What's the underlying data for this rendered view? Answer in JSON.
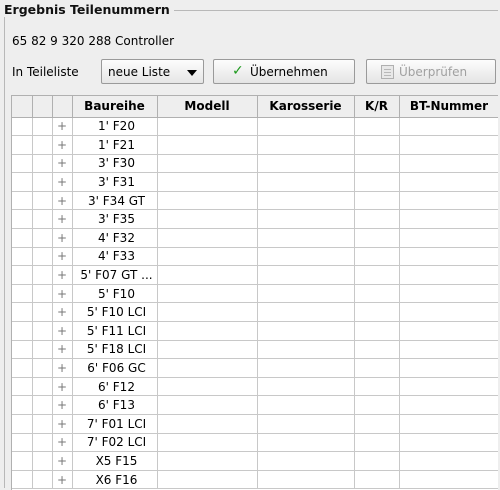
{
  "panel": {
    "title": "Ergebnis Teilenummern",
    "part_line": "65 82 9 320 288 Controller"
  },
  "toolbar": {
    "list_label": "In Teileliste",
    "list_select_value": "neue Liste",
    "apply_label": "Übernehmen",
    "check_label": "Überprüfen",
    "apply_icon": "checkmark-icon",
    "check_icon": "document-icon",
    "apply_icon_color": "#1e9a1e"
  },
  "table": {
    "columns": [
      "",
      "",
      "",
      "Baureihe",
      "Modell",
      "Karosserie",
      "K/R",
      "BT-Nummer"
    ],
    "rows": [
      {
        "expand": "+",
        "baureihe": "1' F20"
      },
      {
        "expand": "+",
        "baureihe": "1' F21"
      },
      {
        "expand": "+",
        "baureihe": "3' F30"
      },
      {
        "expand": "+",
        "baureihe": "3' F31"
      },
      {
        "expand": "+",
        "baureihe": "3' F34 GT"
      },
      {
        "expand": "+",
        "baureihe": "3' F35"
      },
      {
        "expand": "+",
        "baureihe": "4' F32"
      },
      {
        "expand": "+",
        "baureihe": "4' F33"
      },
      {
        "expand": "+",
        "baureihe": "5' F07 GT ..."
      },
      {
        "expand": "+",
        "baureihe": "5' F10"
      },
      {
        "expand": "+",
        "baureihe": "5' F10 LCI"
      },
      {
        "expand": "+",
        "baureihe": "5' F11 LCI"
      },
      {
        "expand": "+",
        "baureihe": "5' F18 LCI"
      },
      {
        "expand": "+",
        "baureihe": "6' F06 GC"
      },
      {
        "expand": "+",
        "baureihe": "6' F12"
      },
      {
        "expand": "+",
        "baureihe": "6' F13"
      },
      {
        "expand": "+",
        "baureihe": "7' F01 LCI"
      },
      {
        "expand": "+",
        "baureihe": "7' F02 LCI"
      },
      {
        "expand": "+",
        "baureihe": "X5 F15"
      },
      {
        "expand": "+",
        "baureihe": "X6 F16"
      }
    ]
  }
}
